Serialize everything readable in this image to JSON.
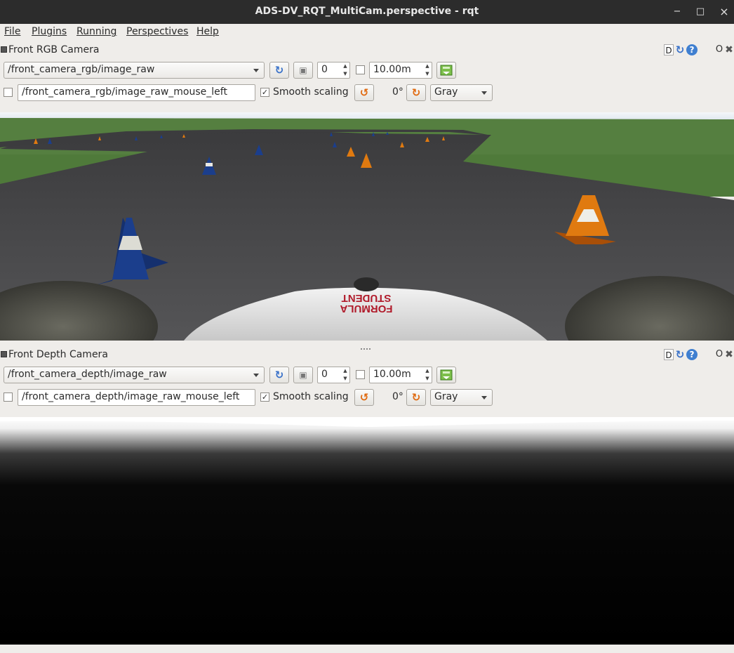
{
  "window": {
    "title": "ADS-DV_RQT_MultiCam.perspective - rqt",
    "minimize": "−",
    "maximize": "□",
    "close": "×"
  },
  "menu": [
    "File",
    "Plugins",
    "Running",
    "Perspectives",
    "Help"
  ],
  "panels": [
    {
      "title": "Front RGB Camera",
      "topic": "/front_camera_rgb/image_raw",
      "num_value": "0",
      "distance": "10.00m",
      "mouse_topic": "/front_camera_rgb/image_raw_mouse_left",
      "smooth_label": "Smooth scaling",
      "smooth_checked": "✓",
      "rotation": "0°",
      "color_scheme": "Gray"
    },
    {
      "title": "Front Depth Camera",
      "topic": "/front_camera_depth/image_raw",
      "num_value": "0",
      "distance": "10.00m",
      "mouse_topic": "/front_camera_depth/image_raw_mouse_left",
      "smooth_label": "Smooth scaling",
      "smooth_checked": "✓",
      "rotation": "0°",
      "color_scheme": "Gray"
    }
  ],
  "title_buttons": {
    "d": "D",
    "o": "O"
  },
  "car_text": [
    "FORMULA",
    "STUDENT"
  ],
  "colors": {
    "accent": "#3f7fd0",
    "cone_blue": "#1b3e8c",
    "cone_orange": "#e07a10",
    "grass": "#4f7a3a",
    "asphalt": "#4a4a4c",
    "sky": "#dde9f2"
  }
}
